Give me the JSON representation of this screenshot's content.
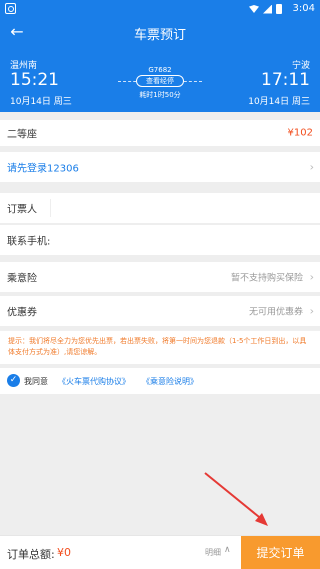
{
  "status_bar": {
    "time": "3:04"
  },
  "header": {
    "title": "车票预订"
  },
  "train": {
    "from_city": "温州南",
    "from_time": "15:21",
    "from_date": "10月14日 周三",
    "to_city": "宁波",
    "to_time": "17:11",
    "to_date": "10月14日 周三",
    "train_no": "G7682",
    "via_label": "查看经停",
    "duration": "耗时1时50分"
  },
  "seat": {
    "label": "二等座",
    "price": "¥102"
  },
  "login": {
    "label": "请先登录12306"
  },
  "booker": {
    "label": "订票人"
  },
  "phone": {
    "label": "联系手机:"
  },
  "insurance": {
    "label": "乘意险",
    "value": "暂不支持购买保险"
  },
  "coupon": {
    "label": "优惠券",
    "value": "无可用优惠券"
  },
  "notice": {
    "text": "提示：我们将尽全力为您优先出票，若出票失败，将第一时间为您退款（1-5个工作日到出，以具体支付方式为准）,请您谅解。"
  },
  "agreement": {
    "prefix": "我同意",
    "link1": "《火车票代购协议》",
    "link2": "《乘意险说明》"
  },
  "footer": {
    "total_label": "订单总额:",
    "total_amount": "¥0",
    "detail_label": "明细",
    "submit_label": "提交订单"
  },
  "colors": {
    "primary": "#1a7ee8",
    "accent": "#f89a2e",
    "price": "#f24e1e",
    "annotation": "#e53935"
  },
  "icons": [
    "camera-icon",
    "wifi-icon",
    "signal-icon",
    "battery-icon",
    "back-arrow-icon",
    "chevron-right-icon",
    "check-icon",
    "chevron-up-icon"
  ]
}
